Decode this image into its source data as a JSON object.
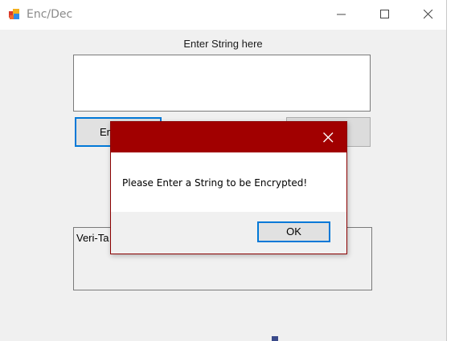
{
  "window": {
    "title": "Enc/Dec"
  },
  "form": {
    "prompt_label": "Enter String here",
    "input_value": "",
    "encrypt_button_label_visible": "En",
    "output_label_visible": "Veri-Ta"
  },
  "dialog": {
    "message": "Please Enter a String to be Encrypted!",
    "ok_label": "OK"
  },
  "colors": {
    "dialog_title_bg": "#a10000",
    "focus_border": "#0078d7",
    "window_bg": "#f0f0f0"
  },
  "icons": {
    "app": "app-icon",
    "minimize": "minimize-icon",
    "maximize": "maximize-icon",
    "close": "close-icon"
  }
}
